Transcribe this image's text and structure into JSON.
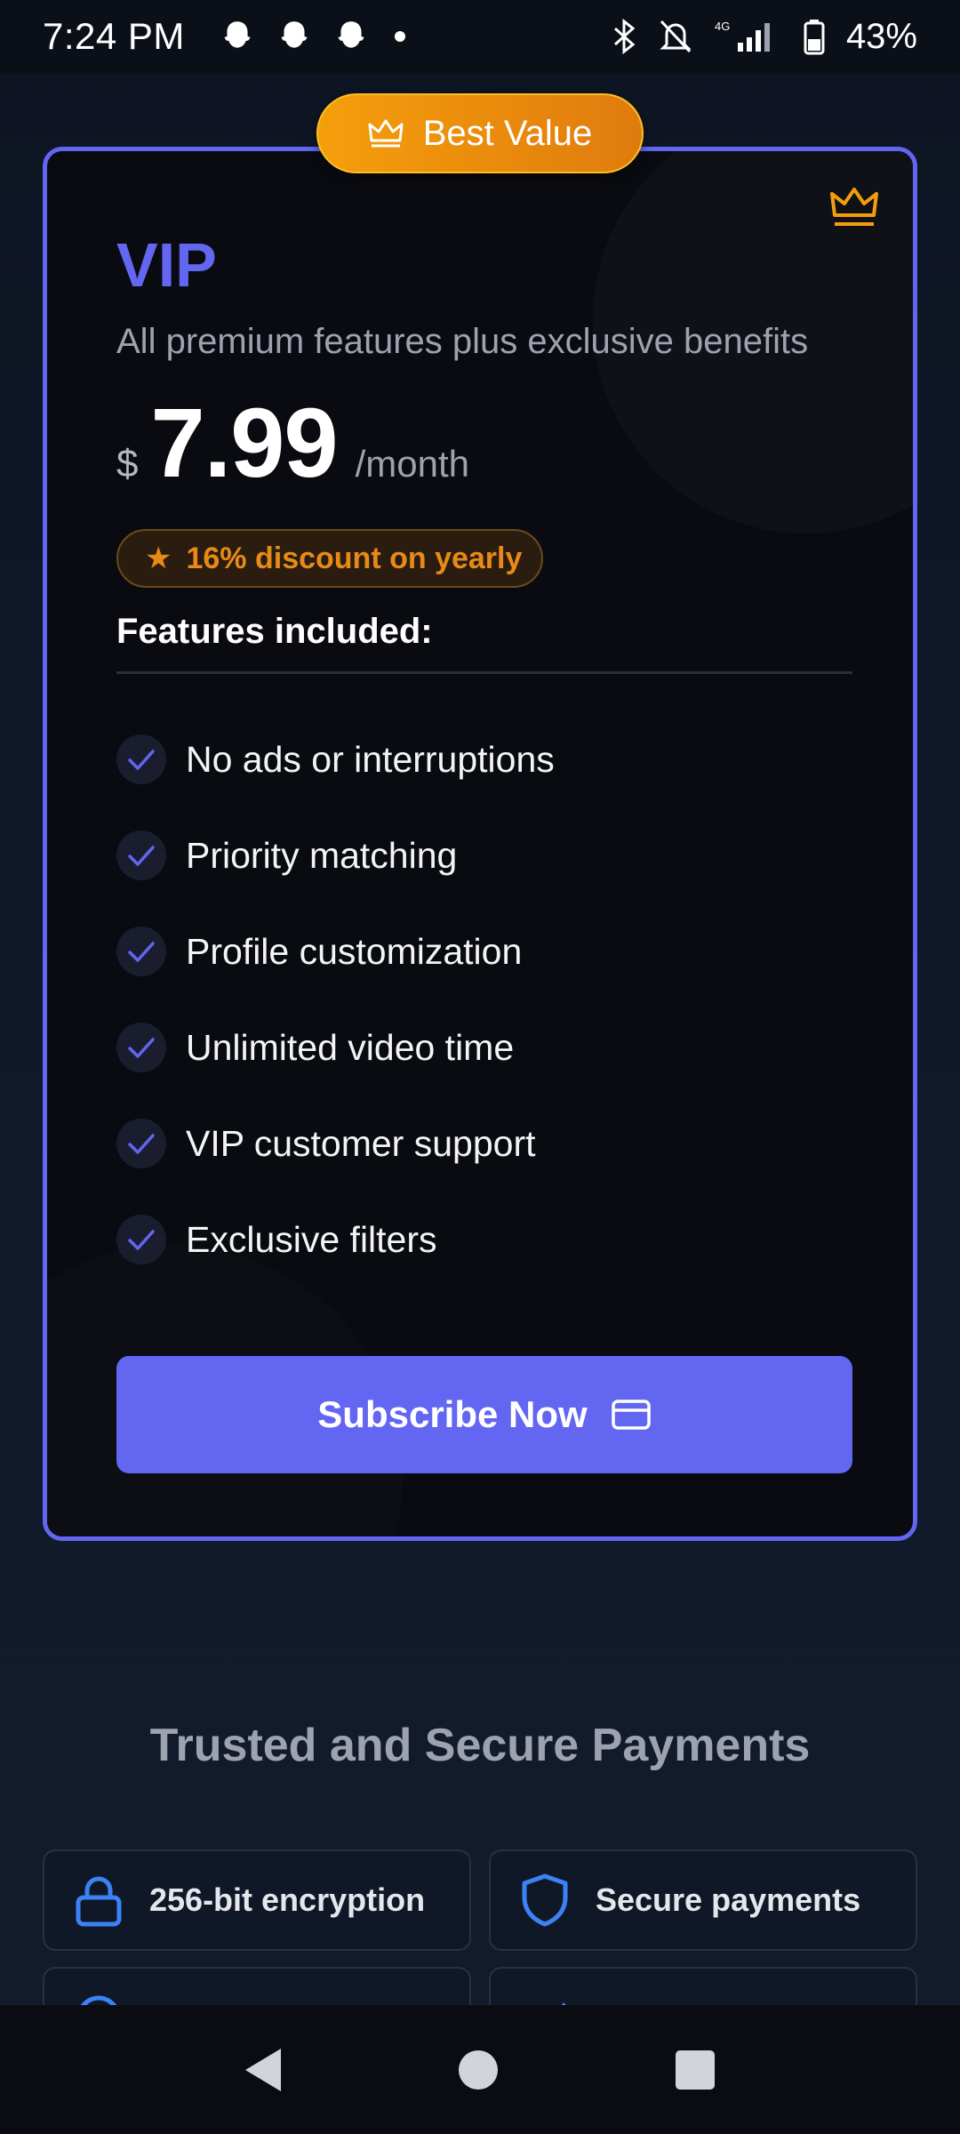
{
  "status_bar": {
    "time": "7:24 PM",
    "network": "4G",
    "battery_percent": "43%"
  },
  "plan": {
    "badge": "Best Value",
    "name": "VIP",
    "description": "All premium features plus exclusive benefits",
    "currency": "$",
    "price": "7.99",
    "period": "/month",
    "discount": "16% discount on yearly",
    "features_title": "Features included:",
    "features": [
      "No ads or interruptions",
      "Priority matching",
      "Profile customization",
      "Unlimited video time",
      "VIP customer support",
      "Exclusive filters"
    ],
    "cta": "Subscribe Now"
  },
  "trust": {
    "title": "Trusted and Secure Payments",
    "items": [
      {
        "label": "256-bit encryption",
        "icon": "lock-icon"
      },
      {
        "label": "Secure payments",
        "icon": "shield-icon"
      }
    ]
  },
  "colors": {
    "accent": "#6366f1",
    "badge": "#f59e0b",
    "discount": "#e88a17",
    "background": "#111a2b",
    "card": "#0a0b10"
  }
}
